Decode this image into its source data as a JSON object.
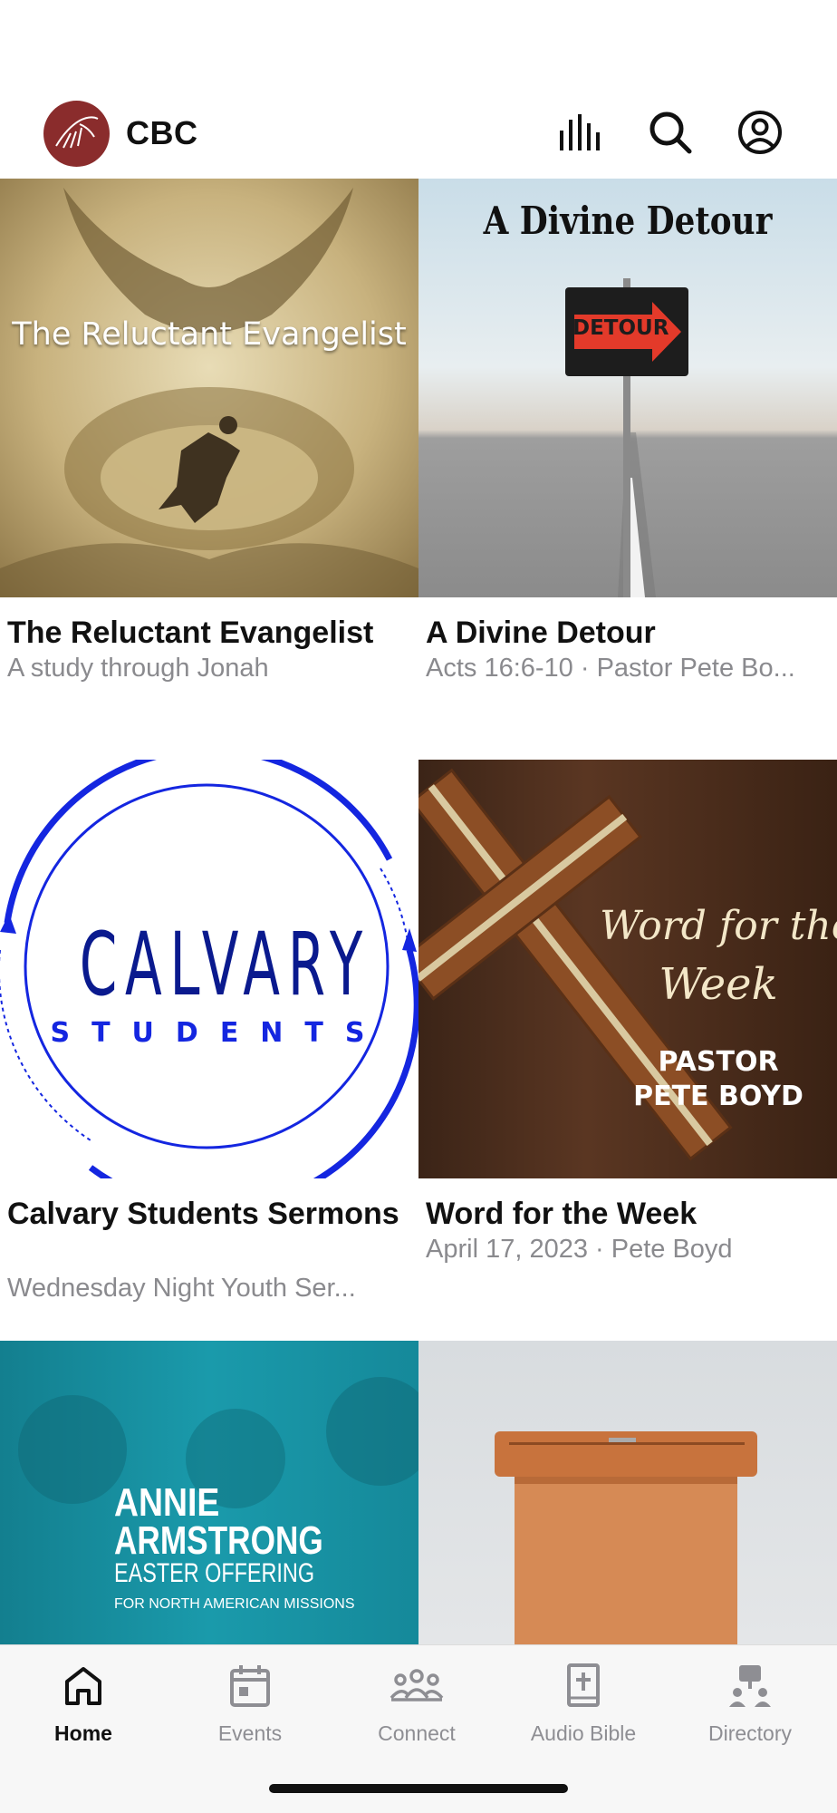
{
  "header": {
    "title": "CBC",
    "icons": [
      "logo-icon",
      "audio-bars-icon",
      "search-icon",
      "account-icon"
    ]
  },
  "cards": [
    {
      "title": "The Reluctant Evangelist",
      "subtitle": "A study through Jonah",
      "art_text": "The Reluctant Evangelist"
    },
    {
      "title": "A Divine Detour",
      "subtitle": "Acts 16:6-10 · Pastor Pete Bo...",
      "art_text": "A Divine Detour",
      "sign_text": "DETOUR"
    },
    {
      "title": "Calvary Students Sermons",
      "subtitle": "Wednesday Night Youth Ser...",
      "art_line1": "CALVARY",
      "art_line2": "STUDENTS"
    },
    {
      "title": "Word for the Week",
      "subtitle": "April 17, 2023 · Pete Boyd",
      "art_script1": "Word for the",
      "art_script2": "Week",
      "art_name1": "PASTOR",
      "art_name2": "PETE BOYD"
    },
    {
      "title": "",
      "subtitle": "",
      "art_line1": "ANNIE",
      "art_line2": "ARMSTRONG",
      "art_line3": "EASTER OFFERING",
      "art_line4": "FOR NORTH AMERICAN MISSIONS"
    },
    {
      "title": "",
      "subtitle": ""
    }
  ],
  "tabbar": {
    "tabs": [
      {
        "label": "Home",
        "icon": "home-icon",
        "active": true
      },
      {
        "label": "Events",
        "icon": "calendar-icon",
        "active": false
      },
      {
        "label": "Connect",
        "icon": "people-icon",
        "active": false
      },
      {
        "label": "Audio Bible",
        "icon": "bible-icon",
        "active": false
      },
      {
        "label": "Directory",
        "icon": "directory-icon",
        "active": false
      }
    ]
  },
  "colors": {
    "brand": "#8a2c2c",
    "calvary_blue": "#1426e0",
    "annie_teal": "#1a9aab",
    "tab_inactive": "#8e8e93"
  }
}
